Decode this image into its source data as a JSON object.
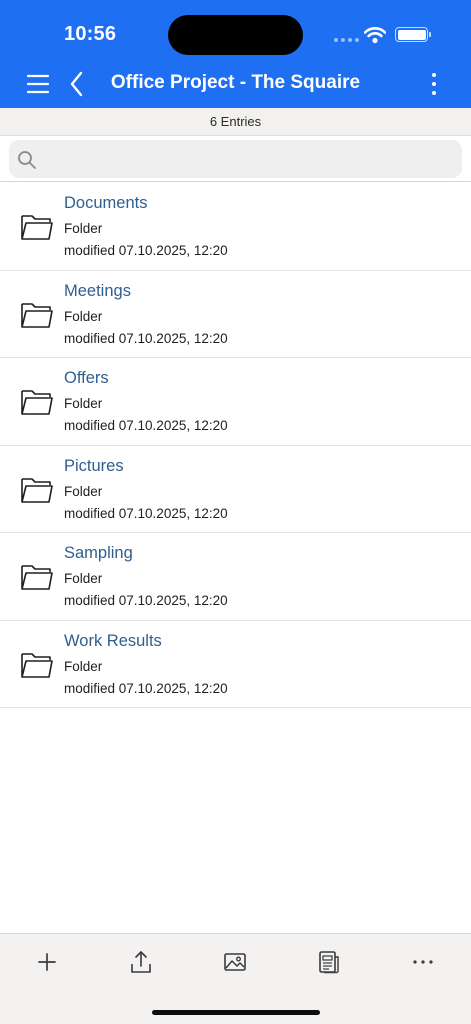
{
  "status": {
    "time": "10:56"
  },
  "header": {
    "title": "Office Project - The Squaire",
    "menu_icon": "hamburger-menu-icon",
    "back_icon": "chevron-left-icon",
    "more_icon": "vertical-ellipsis-icon"
  },
  "entries_label": "6 Entries",
  "search": {
    "placeholder": "",
    "value": ""
  },
  "items": [
    {
      "name": "Documents",
      "kind": "Folder",
      "modified": "modified 07.10.2025, 12:20",
      "icon": "folder-icon"
    },
    {
      "name": "Meetings",
      "kind": "Folder",
      "modified": "modified 07.10.2025, 12:20",
      "icon": "folder-icon"
    },
    {
      "name": "Offers",
      "kind": "Folder",
      "modified": "modified 07.10.2025, 12:20",
      "icon": "folder-icon"
    },
    {
      "name": "Pictures",
      "kind": "Folder",
      "modified": "modified 07.10.2025, 12:20",
      "icon": "folder-icon"
    },
    {
      "name": "Sampling",
      "kind": "Folder",
      "modified": "modified 07.10.2025, 12:20",
      "icon": "folder-icon"
    },
    {
      "name": "Work Results",
      "kind": "Folder",
      "modified": "modified 07.10.2025, 12:20",
      "icon": "folder-icon"
    }
  ],
  "toolbar": {
    "buttons": [
      "plus-icon",
      "upload-icon",
      "image-icon",
      "document-icon",
      "horizontal-ellipsis-icon"
    ]
  },
  "colors": {
    "accent": "#1e6ff1",
    "item_title": "#2f5f8f",
    "toolbar_bg": "#f3f2f0"
  }
}
